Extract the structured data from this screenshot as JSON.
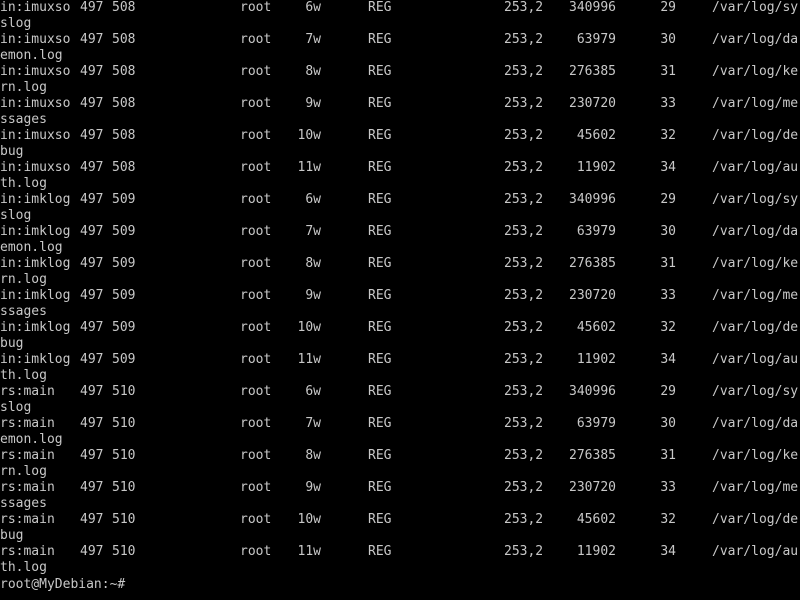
{
  "terminal": {
    "colors": {
      "background": "#000000",
      "foreground": "#c8c8c8"
    },
    "rows": [
      {
        "command": "in:imuxso",
        "pid": "497",
        "tid": "508",
        "user": "root",
        "fd": "6w",
        "type": "REG",
        "device": "253,2",
        "size": "340996",
        "node": "29",
        "name": "/var/log/sy",
        "name_wrap": "slog"
      },
      {
        "command": "in:imuxso",
        "pid": "497",
        "tid": "508",
        "user": "root",
        "fd": "7w",
        "type": "REG",
        "device": "253,2",
        "size": "63979",
        "node": "30",
        "name": "/var/log/da",
        "name_wrap": "emon.log"
      },
      {
        "command": "in:imuxso",
        "pid": "497",
        "tid": "508",
        "user": "root",
        "fd": "8w",
        "type": "REG",
        "device": "253,2",
        "size": "276385",
        "node": "31",
        "name": "/var/log/ke",
        "name_wrap": "rn.log"
      },
      {
        "command": "in:imuxso",
        "pid": "497",
        "tid": "508",
        "user": "root",
        "fd": "9w",
        "type": "REG",
        "device": "253,2",
        "size": "230720",
        "node": "33",
        "name": "/var/log/me",
        "name_wrap": "ssages"
      },
      {
        "command": "in:imuxso",
        "pid": "497",
        "tid": "508",
        "user": "root",
        "fd": "10w",
        "type": "REG",
        "device": "253,2",
        "size": "45602",
        "node": "32",
        "name": "/var/log/de",
        "name_wrap": "bug"
      },
      {
        "command": "in:imuxso",
        "pid": "497",
        "tid": "508",
        "user": "root",
        "fd": "11w",
        "type": "REG",
        "device": "253,2",
        "size": "11902",
        "node": "34",
        "name": "/var/log/au",
        "name_wrap": "th.log"
      },
      {
        "command": "in:imklog",
        "pid": "497",
        "tid": "509",
        "user": "root",
        "fd": "6w",
        "type": "REG",
        "device": "253,2",
        "size": "340996",
        "node": "29",
        "name": "/var/log/sy",
        "name_wrap": "slog"
      },
      {
        "command": "in:imklog",
        "pid": "497",
        "tid": "509",
        "user": "root",
        "fd": "7w",
        "type": "REG",
        "device": "253,2",
        "size": "63979",
        "node": "30",
        "name": "/var/log/da",
        "name_wrap": "emon.log"
      },
      {
        "command": "in:imklog",
        "pid": "497",
        "tid": "509",
        "user": "root",
        "fd": "8w",
        "type": "REG",
        "device": "253,2",
        "size": "276385",
        "node": "31",
        "name": "/var/log/ke",
        "name_wrap": "rn.log"
      },
      {
        "command": "in:imklog",
        "pid": "497",
        "tid": "509",
        "user": "root",
        "fd": "9w",
        "type": "REG",
        "device": "253,2",
        "size": "230720",
        "node": "33",
        "name": "/var/log/me",
        "name_wrap": "ssages"
      },
      {
        "command": "in:imklog",
        "pid": "497",
        "tid": "509",
        "user": "root",
        "fd": "10w",
        "type": "REG",
        "device": "253,2",
        "size": "45602",
        "node": "32",
        "name": "/var/log/de",
        "name_wrap": "bug"
      },
      {
        "command": "in:imklog",
        "pid": "497",
        "tid": "509",
        "user": "root",
        "fd": "11w",
        "type": "REG",
        "device": "253,2",
        "size": "11902",
        "node": "34",
        "name": "/var/log/au",
        "name_wrap": "th.log"
      },
      {
        "command": "rs:main",
        "pid": "497",
        "tid": "510",
        "user": "root",
        "fd": "6w",
        "type": "REG",
        "device": "253,2",
        "size": "340996",
        "node": "29",
        "name": "/var/log/sy",
        "name_wrap": "slog"
      },
      {
        "command": "rs:main",
        "pid": "497",
        "tid": "510",
        "user": "root",
        "fd": "7w",
        "type": "REG",
        "device": "253,2",
        "size": "63979",
        "node": "30",
        "name": "/var/log/da",
        "name_wrap": "emon.log"
      },
      {
        "command": "rs:main",
        "pid": "497",
        "tid": "510",
        "user": "root",
        "fd": "8w",
        "type": "REG",
        "device": "253,2",
        "size": "276385",
        "node": "31",
        "name": "/var/log/ke",
        "name_wrap": "rn.log"
      },
      {
        "command": "rs:main",
        "pid": "497",
        "tid": "510",
        "user": "root",
        "fd": "9w",
        "type": "REG",
        "device": "253,2",
        "size": "230720",
        "node": "33",
        "name": "/var/log/me",
        "name_wrap": "ssages"
      },
      {
        "command": "rs:main",
        "pid": "497",
        "tid": "510",
        "user": "root",
        "fd": "10w",
        "type": "REG",
        "device": "253,2",
        "size": "45602",
        "node": "32",
        "name": "/var/log/de",
        "name_wrap": "bug"
      },
      {
        "command": "rs:main",
        "pid": "497",
        "tid": "510",
        "user": "root",
        "fd": "11w",
        "type": "REG",
        "device": "253,2",
        "size": "11902",
        "node": "34",
        "name": "/var/log/au",
        "name_wrap": "th.log"
      }
    ],
    "prompt": "root@MyDebian:~#"
  }
}
